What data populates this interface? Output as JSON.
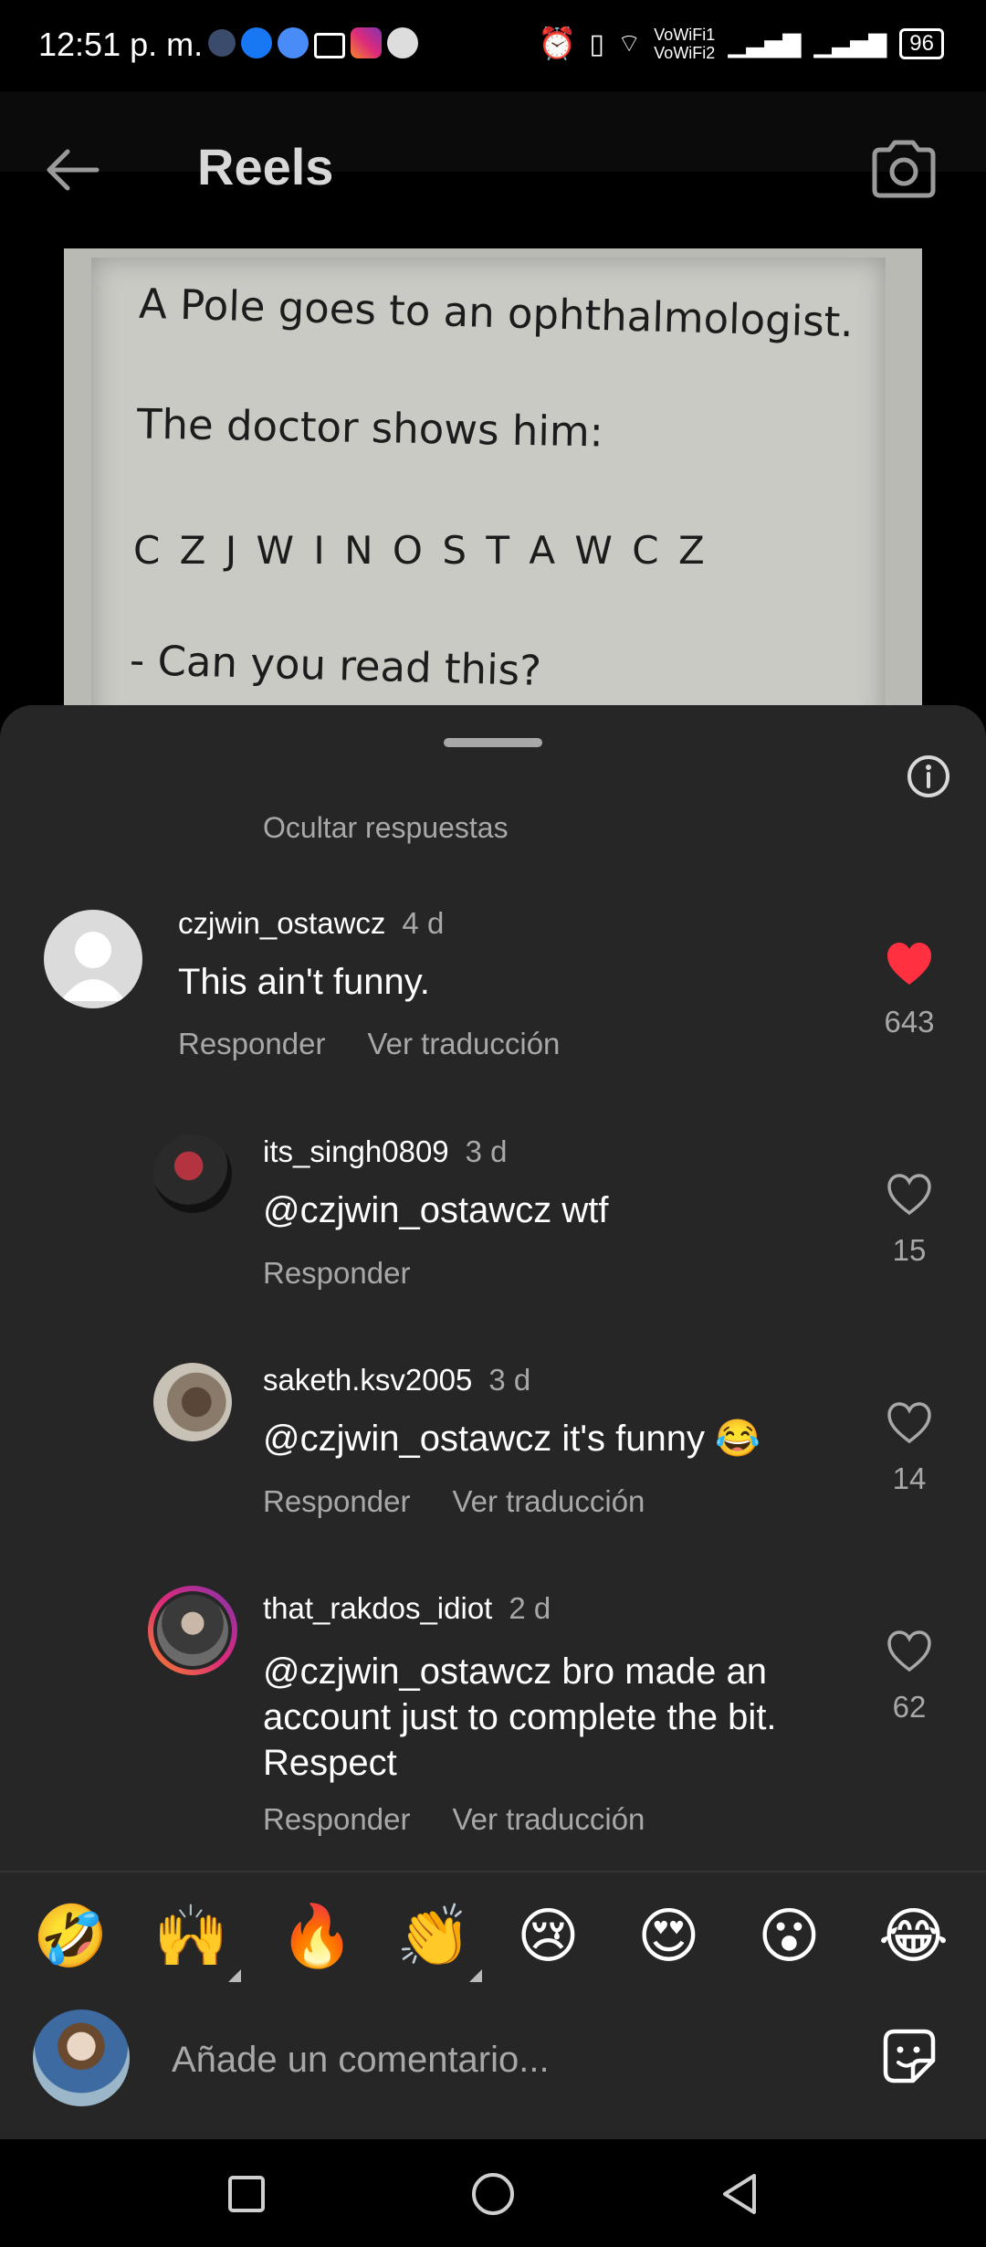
{
  "status_bar": {
    "time": "12:51 p. m.",
    "network_labels": [
      "VoWiFi1",
      "VoWiFi2"
    ],
    "battery": "96"
  },
  "header": {
    "title": "Reels"
  },
  "reel_preview": {
    "lines": [
      "A Pole goes to an ophthalmologist.",
      "The doctor shows him:",
      "C Z J W I N O S T A W C Z",
      "- Can you read this?"
    ]
  },
  "sheet": {
    "hide_replies": "Ocultar respuestas"
  },
  "comments": [
    {
      "username": "czjwin_ostawcz",
      "time": "4 d",
      "text": "This ain't funny.",
      "reply": "Responder",
      "translate": "Ver traducción",
      "likes": "643",
      "liked": true
    },
    {
      "username": "its_singh0809",
      "time": "3 d",
      "text": "@czjwin_ostawcz wtf",
      "reply": "Responder",
      "likes": "15",
      "liked": false
    },
    {
      "username": "saketh.ksv2005",
      "time": "3 d",
      "text": "@czjwin_ostawcz it's funny 😂",
      "reply": "Responder",
      "translate": "Ver traducción",
      "likes": "14",
      "liked": false
    },
    {
      "username": "that_rakdos_idiot",
      "time": "2 d",
      "text_lines": [
        "@czjwin_ostawcz bro made an",
        "account just to complete the bit.",
        "Respect"
      ],
      "reply": "Responder",
      "translate": "Ver traducción",
      "likes": "62",
      "liked": false
    }
  ],
  "emoji_bar": [
    "🤣",
    "🙌",
    "🔥",
    "👏",
    "😢",
    "😍",
    "😮",
    "😂"
  ],
  "comment_box": {
    "placeholder": "Añade un comentario..."
  },
  "colors": {
    "like_red": "#ff3040",
    "sheet_bg": "#262626",
    "secondary_text": "#a8a8a8"
  }
}
